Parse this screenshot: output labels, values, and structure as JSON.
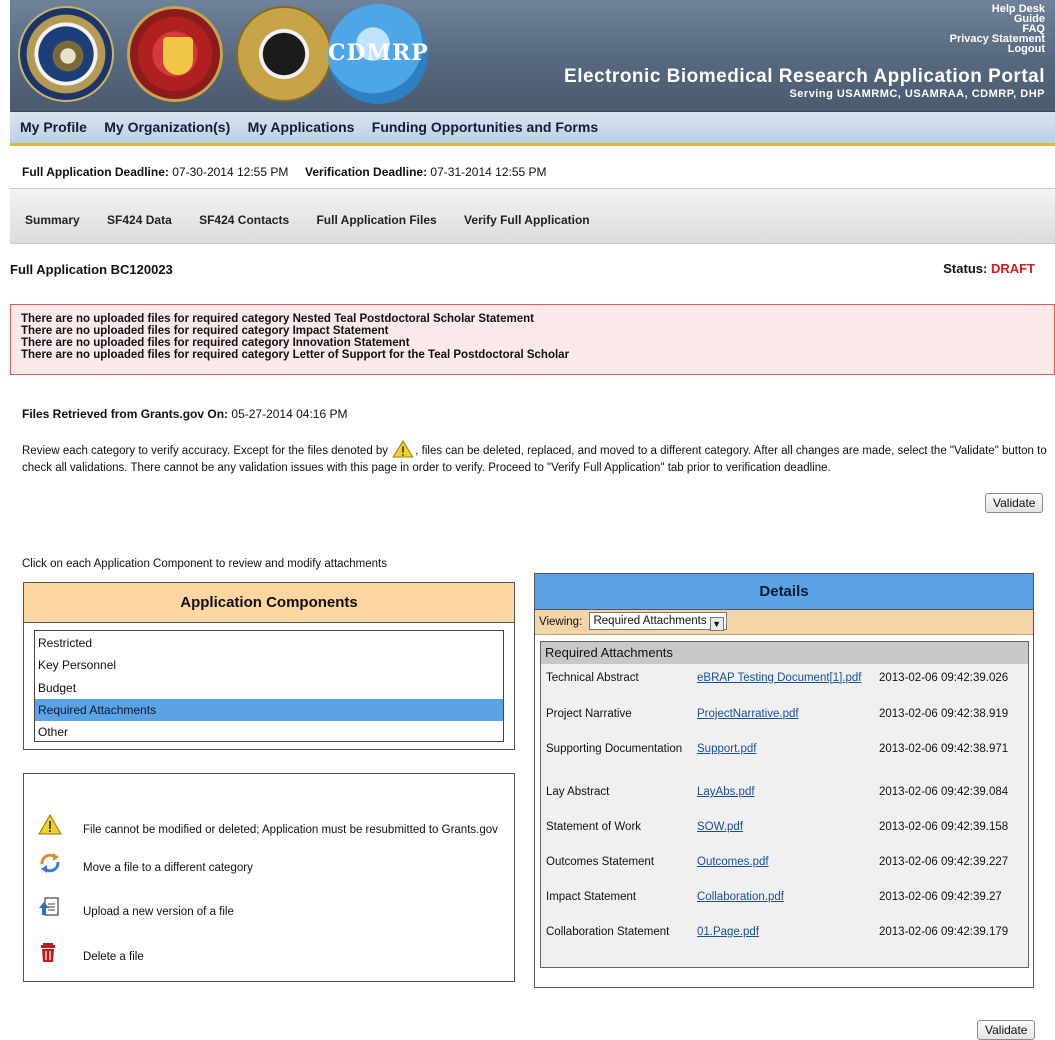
{
  "header": {
    "links": [
      "Help Desk",
      "Guide",
      "FAQ",
      "Privacy Statement",
      "Logout"
    ],
    "title": "Electronic Biomedical Research Application Portal",
    "subtitle": "Serving USAMRMC, USAMRAA, CDMRP, DHP",
    "cdmrp_logo_text": "CDMRP"
  },
  "mainnav": [
    "My Profile",
    "My Organization(s)",
    "My Applications",
    "Funding Opportunities and Forms"
  ],
  "deadlines": {
    "full_label": "Full Application Deadline:",
    "full_value": "07-30-2014 12:55 PM",
    "verify_label": "Verification Deadline:",
    "verify_value": "07-31-2014 12:55 PM"
  },
  "subnav": [
    "Summary",
    "SF424 Data",
    "SF424 Contacts",
    "Full Application Files",
    "Verify Full Application"
  ],
  "application": {
    "title": "Full Application BC120023",
    "status_label": "Status:",
    "status_value": "DRAFT"
  },
  "errors": [
    "There are no uploaded files for required category Nested Teal Postdoctoral Scholar Statement",
    "There are no uploaded files for required category Impact Statement",
    "There are no uploaded files for required category Innovation Statement",
    "There are no uploaded files for required category Letter of Support for the Teal Postdoctoral Scholar"
  ],
  "retrieved": {
    "label": "Files Retrieved from Grants.gov On:",
    "value": "05-27-2014 04:16 PM"
  },
  "instructions": {
    "before_icon": "Review each category to verify accuracy. Except for the files denoted by",
    "after_icon": ", files can be deleted, replaced, and moved to a different category. After all changes are made, select the \"Validate\" button to check all validations. There cannot be any validation issues with this page in order to verify. Proceed to \"Verify Full Application\" tab prior to verification deadline."
  },
  "validate_label": "Validate",
  "click_hint": "Click on each Application Component to review and modify attachments",
  "components": {
    "title": "Application Components",
    "items": [
      "Restricted",
      "Key Personnel",
      "Budget",
      "Required Attachments",
      "Other"
    ],
    "selected": "Required Attachments"
  },
  "legend": [
    {
      "icon": "warning-icon",
      "label": "File cannot be modified or deleted; Application must be resubmitted to Grants.gov"
    },
    {
      "icon": "move-icon",
      "label": "Move a file to a different category"
    },
    {
      "icon": "upload-icon",
      "label": "Upload a new version of a file"
    },
    {
      "icon": "delete-icon",
      "label": "Delete a file"
    }
  ],
  "details": {
    "title": "Details",
    "viewing_label": "Viewing:",
    "viewing_value": "Required Attachments",
    "category": "Required Attachments",
    "rows": [
      {
        "name": "Technical Abstract",
        "file": "eBRAP Testing Document[1].pdf",
        "date": "2013-02-06 09:42:39.026"
      },
      {
        "name": "Project Narrative",
        "file": "ProjectNarrative.pdf",
        "date": "2013-02-06 09:42:38.919"
      },
      {
        "name": "Supporting Documentation",
        "file": "Support.pdf",
        "date": "2013-02-06 09:42:38.971"
      },
      {
        "name": "Lay Abstract",
        "file": "LayAbs.pdf",
        "date": "2013-02-06 09:42:39.084"
      },
      {
        "name": "Statement of Work",
        "file": "SOW.pdf",
        "date": "2013-02-06 09:42:39.158"
      },
      {
        "name": "Outcomes Statement",
        "file": "Outcomes.pdf",
        "date": "2013-02-06 09:42:39.227"
      },
      {
        "name": "Impact Statement",
        "file": "Collaboration.pdf",
        "date": "2013-02-06 09:42:39.27"
      },
      {
        "name": "Collaboration Statement",
        "file": "01.Page.pdf",
        "date": "2013-02-06 09:42:39.179"
      }
    ]
  },
  "colors": {
    "banner": "#56687f",
    "nav": "#bcd0e4",
    "accent_gold": "#e2b43a",
    "error_bg": "#fbe9e9",
    "error_border": "#e05a5a",
    "status_red": "#d81c1c",
    "components_header": "#fbd6a0",
    "details_header": "#5ba3e6",
    "selected_item": "#5ba3e6",
    "link": "#1a4f9a"
  }
}
